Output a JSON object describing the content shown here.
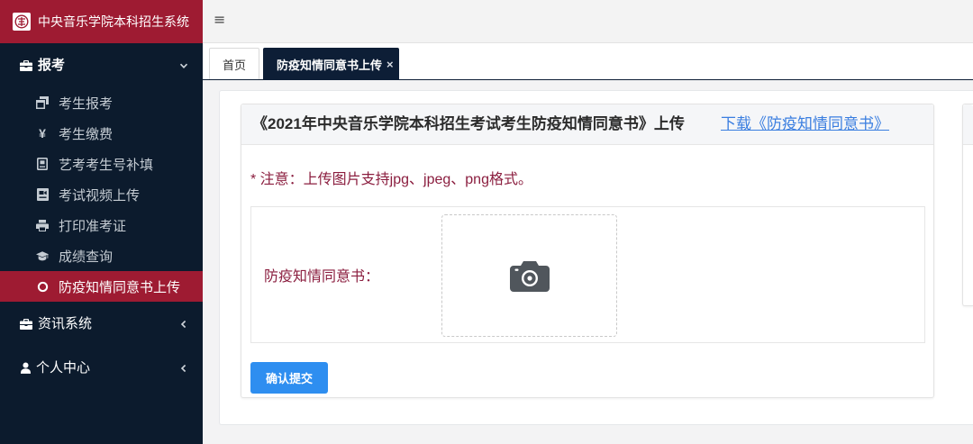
{
  "app": {
    "title": "中央音乐学院本科招生系统",
    "logo_icon": "school-emblem-icon"
  },
  "topbar": {
    "menu_toggle_icon": "hamburger-icon",
    "menu_toggle_glyph": "≡"
  },
  "sidebar": {
    "groups": [
      {
        "label": "报考",
        "icon": "briefcase-icon",
        "expanded": true,
        "items": [
          {
            "label": "考生报考",
            "icon": "window-restore-icon"
          },
          {
            "label": "考生缴费",
            "icon": "yen-icon",
            "glyph": "¥"
          },
          {
            "label": "艺考考生号补填",
            "icon": "id-card-icon"
          },
          {
            "label": "考试视频上传",
            "icon": "video-file-icon"
          },
          {
            "label": "打印准考证",
            "icon": "print-icon"
          },
          {
            "label": "成绩查询",
            "icon": "graduation-cap-icon"
          },
          {
            "label": "防疫知情同意书上传",
            "icon": "circle-icon",
            "active": true
          }
        ]
      },
      {
        "label": "资讯系统",
        "icon": "briefcase-icon",
        "expanded": false
      },
      {
        "label": "个人中心",
        "icon": "user-icon",
        "expanded": false
      }
    ]
  },
  "tabs": [
    {
      "label": "首页",
      "active": false
    },
    {
      "label": "防疫知情同意书上传",
      "active": true,
      "close_icon": "close-icon",
      "close_glyph": "×"
    }
  ],
  "panel": {
    "title": "《2021年中央音乐学院本科招生考试考生防疫知情同意书》上传",
    "download_link": "下载《防疫知情同意书》",
    "notice": "* 注意：上传图片支持jpg、jpeg、png格式。",
    "field_label": "防疫知情同意书：",
    "upload_icon": "camera-icon",
    "submit_label": "确认提交"
  },
  "colors": {
    "brand": "#9e1b32",
    "sidebar_bg": "#0c1b2d",
    "active_tab_bg": "#0d1e36",
    "accent_text": "#8b1e3f",
    "link": "#3a7ee0",
    "button": "#2e8ef0"
  }
}
